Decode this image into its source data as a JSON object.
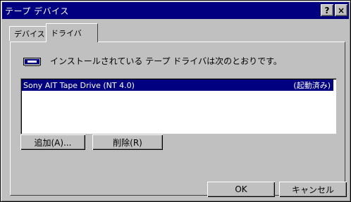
{
  "window": {
    "title": "テープ デバイス",
    "help_label": "?",
    "close_label": "×"
  },
  "tabs": [
    {
      "label": "デバイス"
    },
    {
      "label": "ドライバ"
    }
  ],
  "panel": {
    "info_text": "インストールされている テープ ドライバは次のとおりです。",
    "drivers": [
      {
        "name": "Sony AIT Tape Drive (NT 4.0)",
        "status": "(起動済み)"
      }
    ],
    "add_button": "追加(A)...",
    "remove_button": "削除(R)"
  },
  "footer": {
    "ok_button": "OK",
    "cancel_button": "キャンセル"
  },
  "colors": {
    "face": "#c0c0c0",
    "titlebar": "#000080",
    "selection": "#000080"
  },
  "icons": {
    "driver": "tape-drive-icon"
  }
}
